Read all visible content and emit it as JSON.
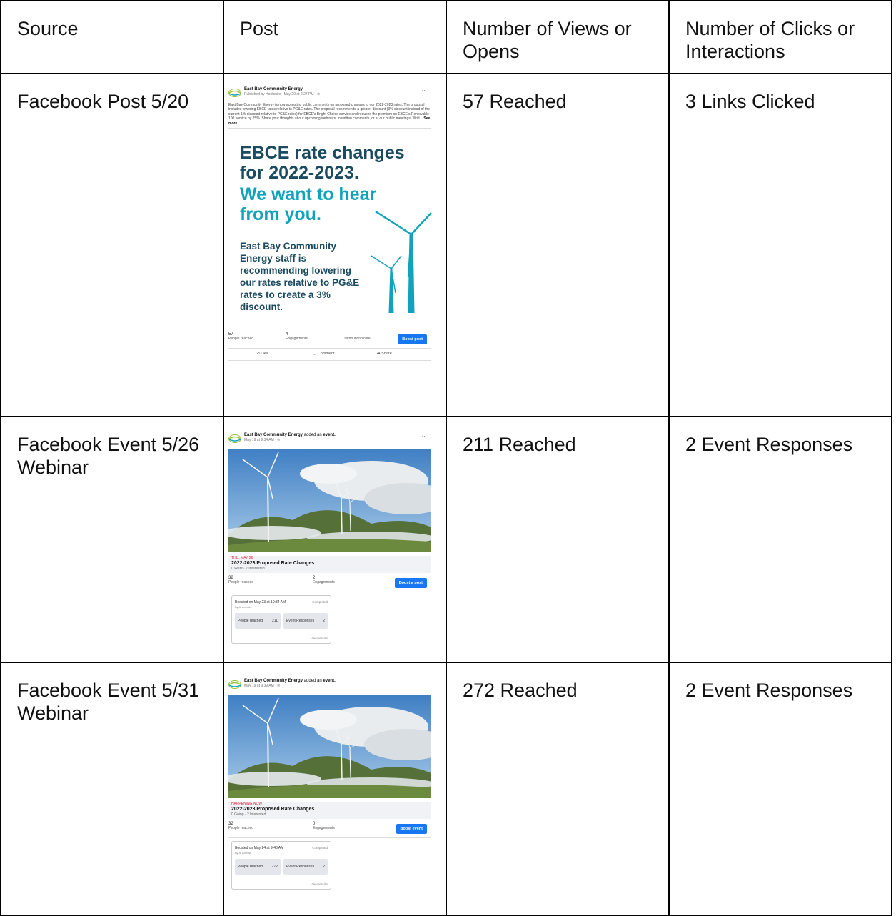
{
  "headers": [
    "Source",
    "Post",
    "Number of Views or Opens",
    "Number of Clicks or Interactions"
  ],
  "rows": [
    {
      "source": "Facebook Post 5/20",
      "views": "57 Reached",
      "clicks": "3 Links Clicked"
    },
    {
      "source": "Facebook Event 5/26 Webinar",
      "views": "211 Reached",
      "clicks": "2 Event Responses"
    },
    {
      "source": "Facebook Event 5/31 Webinar",
      "views": "272 Reached",
      "clicks": "2 Event Responses"
    }
  ],
  "post1": {
    "page_name": "East Bay Community Energy",
    "meta": "Published by Hootsuite · May 20 at 2:27 PM ·",
    "body": "East Bay Community Energy is now accepting public comments on proposed changes to our 2022-2023 rates. The proposal includes lowering EBCE rates relative to PG&E rates. The proposal recommends a greater discount (3% discount instead of the current 1% discount relative to PG&E rates) for EBCE's Bright Choice service and reduces the premium on EBCE's Renewable 100 service by 25%. Share your thoughts at our upcoming webinars, in written comments, or at our public meetings. Writt...",
    "see_more": "See more",
    "graphic_title_1": "EBCE rate changes for 2022-2023.",
    "graphic_title_2": "We want to hear from you.",
    "graphic_body": "East Bay Community Energy staff is recommending lowering our rates relative to PG&E rates to create a 3% discount.",
    "stat1_num": "57",
    "stat1_label": "People reached",
    "stat2_num": "4",
    "stat2_label": "Engagements",
    "stat3_num": "--",
    "stat3_label": "Distribution score",
    "boost_label": "Boost post",
    "like": "Like",
    "comment": "Comment",
    "share": "Share",
    "more": "···"
  },
  "event1": {
    "page_name": "East Bay Community Energy",
    "added": "added an",
    "added_obj": "event.",
    "meta": "May 19 at 9:34 AM ·",
    "date": "THU, MAY 26",
    "title": "2022-2023 Proposed Rate Changes",
    "sub": "0 Went · 7 Interested",
    "stat1_num": "32",
    "stat1_label": "People reached",
    "stat2_num": "2",
    "stat2_label": "Engagements",
    "boost_label": "Boost a post",
    "boosted_on": "Boosted on May 23 at 10:34 AM",
    "by": "By Al Armola",
    "status": "Completed",
    "pill1_label": "People reached",
    "pill1_value": "211",
    "pill2_label": "Event Responses",
    "pill2_value": "2",
    "view_results": "View results",
    "more": "···"
  },
  "event2": {
    "page_name": "East Bay Community Energy",
    "added": "added an",
    "added_obj": "event.",
    "meta": "May 19 at 9:39 AM ·",
    "date": "HAPPENING NOW",
    "title": "2022-2023 Proposed Rate Changes",
    "sub": "0 Going · 2 Interested",
    "stat1_num": "32",
    "stat1_label": "People reached",
    "stat2_num": "0",
    "stat2_label": "Engagements",
    "boost_label": "Boost event",
    "boosted_on": "Boosted on May 24 at 9:43 AM",
    "by": "By Al Armola",
    "status": "Completed",
    "pill1_label": "People reached",
    "pill1_value": "272",
    "pill2_label": "Event Responses",
    "pill2_value": "2",
    "view_results": "View results",
    "more": "···"
  },
  "colors": {
    "ebce_dark": "#1b4b60",
    "ebce_teal": "#12a3bc",
    "fb_blue": "#1877f2",
    "event_red": "#e41e3f"
  }
}
